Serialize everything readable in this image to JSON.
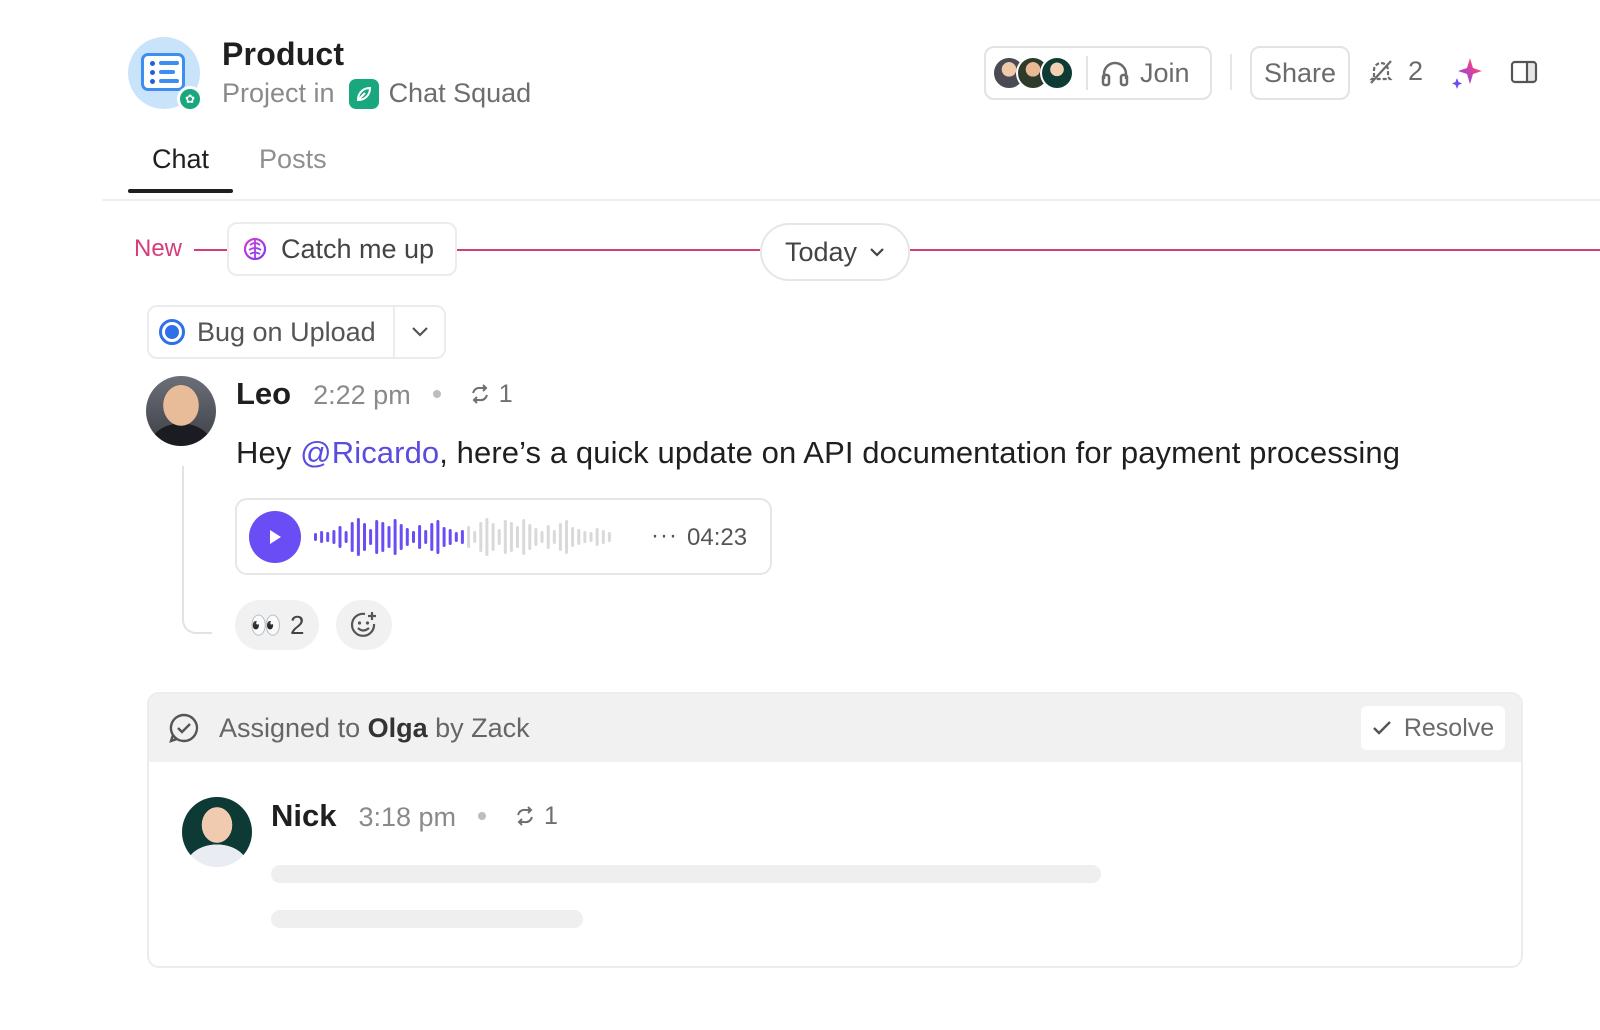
{
  "project": {
    "title": "Product",
    "subtitle_prefix": "Project in",
    "space_name": "Chat Squad"
  },
  "header_actions": {
    "join_label": "Join",
    "share_label": "Share",
    "follower_count": "2"
  },
  "tabs": [
    {
      "label": "Chat",
      "active": true
    },
    {
      "label": "Posts",
      "active": false
    }
  ],
  "divider": {
    "new_label": "New",
    "catch_up_label": "Catch me up",
    "date_label": "Today"
  },
  "thread": {
    "title": "Bug on Upload"
  },
  "message_leo": {
    "author": "Leo",
    "time": "2:22 pm",
    "reply_count": "1",
    "text_before": "Hey ",
    "mention": "@Ricardo",
    "text_after": ", here’s a quick update on API documentation for payment processing",
    "voice_duration": "04:23",
    "voice_progress": 0.5,
    "reaction_emoji": "👀",
    "reaction_count": "2"
  },
  "assignment": {
    "prefix": "Assigned to ",
    "assignee": "Olga",
    "suffix": " by Zack",
    "resolve_label": "Resolve"
  },
  "message_nick": {
    "author": "Nick",
    "time": "3:18 pm",
    "reply_count": "1"
  },
  "colors": {
    "accent_purple": "#6a4df4",
    "mention": "#5b4ce0",
    "new_divider": "#d53d7a",
    "status_blue": "#2f6fe8",
    "space_green": "#19a87e"
  },
  "icons": {
    "project": "list-doc-icon",
    "space": "leaf-icon",
    "join": "headphones-icon",
    "follow": "bell-off-icon",
    "ai": "sparkle-icon",
    "panel": "sidebar-toggle-icon",
    "catch_up": "ai-brain-icon",
    "date_caret": "chevron-down-icon",
    "replies": "reply-arrows-icon",
    "play": "play-icon",
    "add_reaction": "add-emoji-icon",
    "assigned": "check-bubble-icon",
    "resolve": "check-icon"
  }
}
